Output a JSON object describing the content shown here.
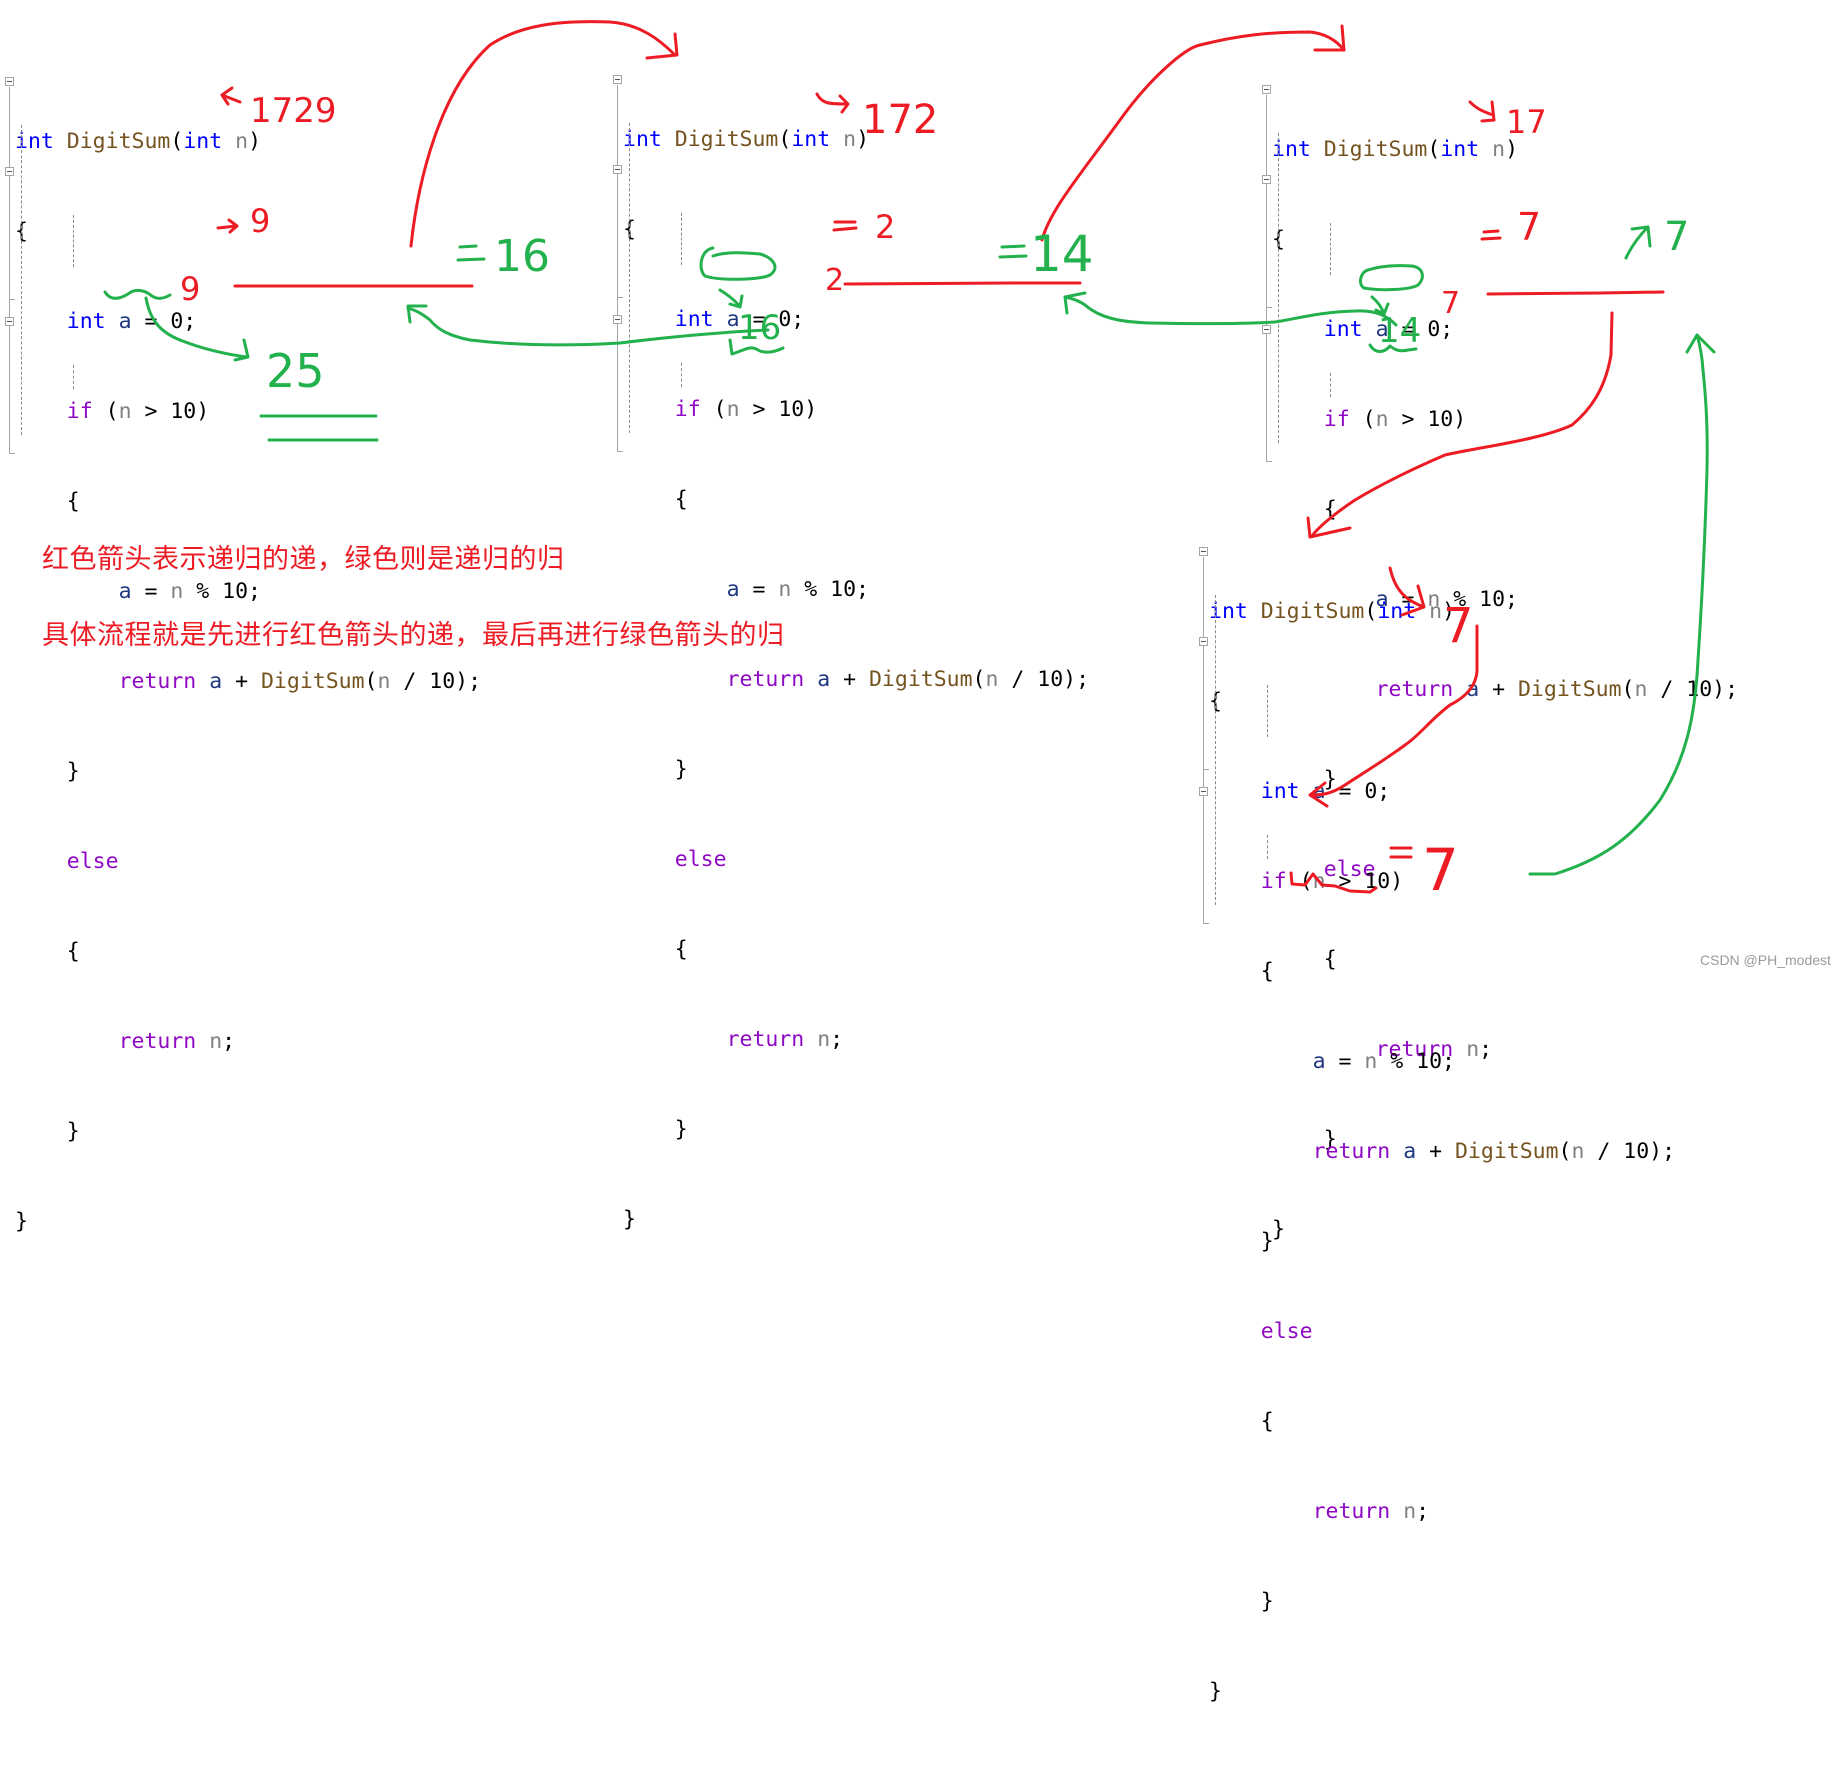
{
  "code": {
    "signature": {
      "type": "int",
      "name": "DigitSum",
      "open": "(",
      "ptype": "int",
      "param": "n",
      "close": ")"
    },
    "lines": {
      "open_brace": "{",
      "decl_type": "int",
      "decl_var": "a",
      "decl_rest": " = 0;",
      "if_kw": "if",
      "if_open": " (",
      "if_var": "n",
      "if_rest": " > 10)",
      "inner_open": "{",
      "assign_var": "a",
      "assign_eq": " = ",
      "assign_n": "n",
      "assign_rest": " % 10;",
      "return_kw": "return",
      "ret_sp": " ",
      "ret_a": "a",
      "ret_plus": " + ",
      "ret_fn": "DigitSum",
      "ret_open": "(",
      "ret_n": "n",
      "ret_rest": " / 10);",
      "inner_close": "}",
      "else_kw": "else",
      "else_open": "{",
      "ret2_kw": "return",
      "ret2_sp": " ",
      "ret2_n": "n",
      "ret2_semi": ";",
      "else_close": "}",
      "close_brace": "}"
    }
  },
  "blocks": [
    {
      "id": "call-1",
      "input_n": "1729",
      "a_value": "9",
      "return_a": "9",
      "recursive_result": "16",
      "final_result": "25"
    },
    {
      "id": "call-2",
      "input_n": "172",
      "a_value": "2",
      "return_a": "2",
      "recursive_result": "14",
      "returned_value": "16"
    },
    {
      "id": "call-3",
      "input_n": "17",
      "a_value": "7",
      "return_a": "7",
      "recursive_result": "7",
      "returned_value": "14"
    },
    {
      "id": "call-4",
      "input_n": "7",
      "return_n": "7"
    }
  ],
  "annotations": {
    "note_line_1": "红色箭头表示递归的递，绿色则是递归的归",
    "note_line_2": "具体流程就是先进行红色箭头的递，最后再进行绿色箭头的归",
    "eq_sign": "=",
    "red_meaning": "递 (recursion descent)",
    "green_meaning": "归 (recursion return)"
  },
  "colors": {
    "red_ink": "#ed1c24",
    "green_ink": "#22b14c",
    "keyword_type": "#0000ff",
    "keyword_control": "#8f08c4",
    "function_name": "#74531f",
    "parameter": "#808080",
    "local_variable": "#1f377f"
  },
  "watermark": "CSDN @PH_modest"
}
